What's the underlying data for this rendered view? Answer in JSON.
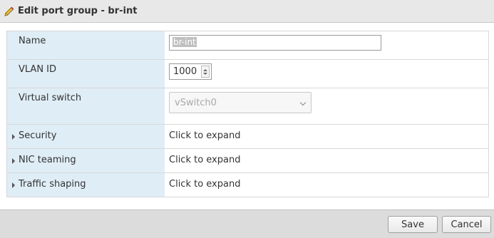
{
  "dialog": {
    "title": "Edit port group - br-int",
    "title_icon": "pencil-icon"
  },
  "form": {
    "name_label": "Name",
    "name_value": "br-int",
    "vlan_label": "VLAN ID",
    "vlan_value": "1000",
    "vswitch_label": "Virtual switch",
    "vswitch_value": "vSwitch0",
    "sections": [
      {
        "label": "Security",
        "value": "Click to expand"
      },
      {
        "label": "NIC teaming",
        "value": "Click to expand"
      },
      {
        "label": "Traffic shaping",
        "value": "Click to expand"
      }
    ]
  },
  "footer": {
    "save_label": "Save",
    "cancel_label": "Cancel"
  },
  "colors": {
    "label_bg": "#dfedf6",
    "footer_bg": "#dcdcdc",
    "titlebar_bg": "#e8e8e8"
  }
}
